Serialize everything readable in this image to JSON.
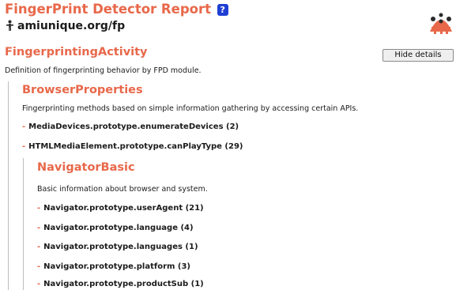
{
  "header": {
    "title": "FingerPrint Detector Report",
    "help_icon_label": "?",
    "site": "amiunique.org/fp"
  },
  "toolbar": {
    "hide_details_label": "Hide details"
  },
  "activity": {
    "title": "FingerprintingActivity",
    "description": "Definition of fingerprinting behavior by FPD module."
  },
  "browser_properties": {
    "title": "BrowserProperties",
    "description": "Fingerprinting methods based on simple information gathering by accessing certain APIs.",
    "items": [
      {
        "dash": "-",
        "label": "MediaDevices.prototype.enumerateDevices (2)"
      },
      {
        "dash": "-",
        "label": "HTMLMediaElement.prototype.canPlayType (29)"
      }
    ]
  },
  "navigator_basic": {
    "title": "NavigatorBasic",
    "description": "Basic information about browser and system.",
    "items": [
      {
        "dash": "-",
        "label": "Navigator.prototype.userAgent (21)"
      },
      {
        "dash": "-",
        "label": "Navigator.prototype.language (4)"
      },
      {
        "dash": "-",
        "label": "Navigator.prototype.languages (1)"
      },
      {
        "dash": "-",
        "label": "Navigator.prototype.platform (3)"
      },
      {
        "dash": "-",
        "label": "Navigator.prototype.productSub (1)"
      }
    ]
  },
  "colors": {
    "accent": "#e8684a",
    "help_icon": "#1f3fd4",
    "text": "#1b1b1b",
    "tree_line": "#bdbdbd"
  },
  "icons": {
    "help": "help-icon",
    "site": "person-icon",
    "logo": "fingerprint-detector-logo"
  }
}
